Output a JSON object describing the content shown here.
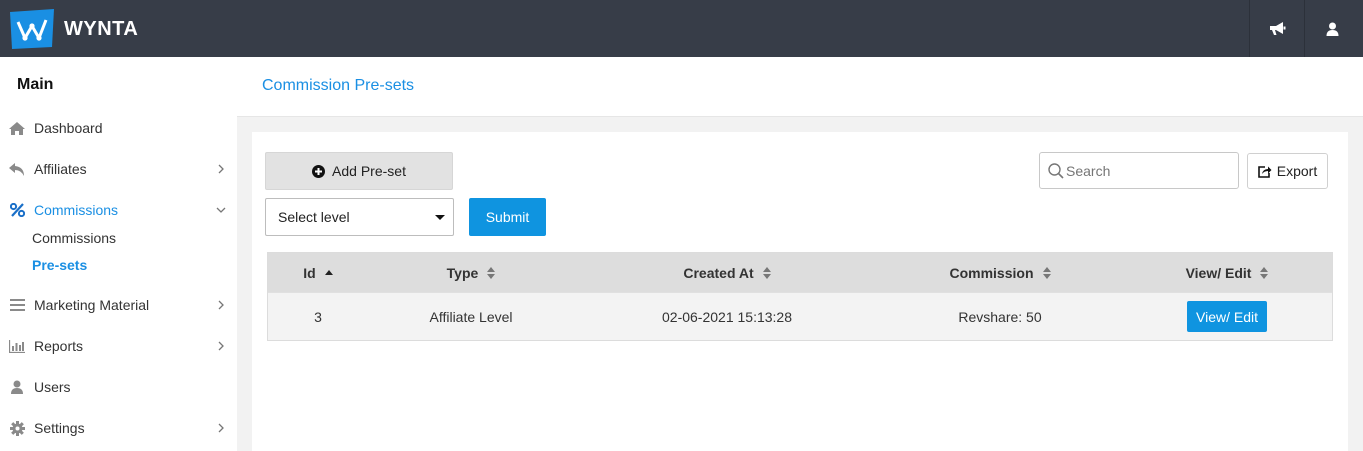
{
  "brand": {
    "name": "WYNTA"
  },
  "topbar": {
    "icons": [
      "bullhorn-icon",
      "user-icon"
    ]
  },
  "sidebar": {
    "title": "Main",
    "items": [
      {
        "label": "Dashboard",
        "icon": "home-icon"
      },
      {
        "label": "Affiliates",
        "icon": "reply-icon"
      },
      {
        "label": "Commissions",
        "icon": "percent-icon"
      },
      {
        "label": "Marketing Material",
        "icon": "bars-icon"
      },
      {
        "label": "Reports",
        "icon": "bar-chart-icon"
      },
      {
        "label": "Users",
        "icon": "user-icon"
      },
      {
        "label": "Settings",
        "icon": "gear-icon"
      }
    ],
    "subitems": [
      {
        "label": "Commissions"
      },
      {
        "label": "Pre-sets"
      }
    ]
  },
  "page": {
    "title": "Commission Pre-sets"
  },
  "toolbar": {
    "add_label": "Add Pre-set",
    "select_value": "Select level",
    "submit_label": "Submit",
    "search_placeholder": "Search",
    "export_label": "Export"
  },
  "table": {
    "columns": [
      "Id",
      "Type",
      "Created At",
      "Commission",
      "View/ Edit"
    ],
    "rows": [
      {
        "id": "3",
        "type": "Affiliate Level",
        "created_at": "02-06-2021 15:13:28",
        "commission": "Revshare: 50",
        "action": "View/ Edit"
      }
    ]
  },
  "colors": {
    "accent": "#1a8fe3",
    "button": "#0f94e0",
    "topbar": "#373d48"
  }
}
